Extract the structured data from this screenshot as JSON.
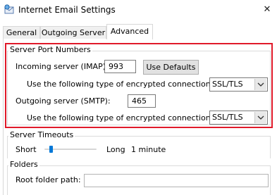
{
  "window": {
    "title": "Internet Email Settings",
    "close_glyph": "✕",
    "icon": "envelope-globe-icon"
  },
  "tabs": [
    {
      "label": "General"
    },
    {
      "label": "Outgoing Server"
    },
    {
      "label": "Advanced",
      "active": true
    }
  ],
  "server_ports": {
    "group_label": "Server Port Numbers",
    "incoming_label": "Incoming server (IMAP):",
    "incoming_value": "993",
    "use_defaults_label": "Use Defaults",
    "incoming_encryption_label": "Use the following type of encrypted connection:",
    "incoming_encryption_value": "SSL/TLS",
    "outgoing_label": "Outgoing server (SMTP):",
    "outgoing_value": "465",
    "outgoing_encryption_label": "Use the following type of encrypted connection:",
    "outgoing_encryption_value": "SSL/TLS",
    "highlight_color": "#e01a2a"
  },
  "timeouts": {
    "group_label": "Server Timeouts",
    "short_label": "Short",
    "long_label": "Long",
    "value_text": "1 minute",
    "slider_level": 0.1
  },
  "folders": {
    "group_label": "Folders",
    "root_label": "Root folder path:",
    "root_value": ""
  },
  "colors": {
    "accent": "#0078d7",
    "highlight": "#e01a2a"
  }
}
